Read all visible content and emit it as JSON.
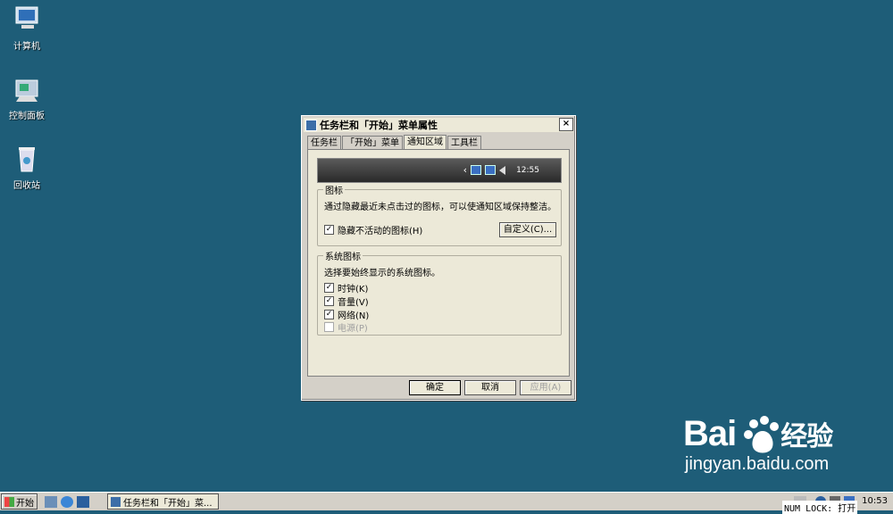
{
  "desktop": {
    "icons": [
      {
        "label": "计算机"
      },
      {
        "label": "控制面板"
      },
      {
        "label": "回收站"
      }
    ]
  },
  "dialog": {
    "title": "任务栏和「开始」菜单属性",
    "close": "×",
    "tabs": [
      "任务栏",
      "「开始」菜单",
      "通知区域",
      "工具栏"
    ],
    "active_tab": "通知区域",
    "preview": {
      "chevron": "‹",
      "time": "12:55"
    },
    "icons_group": {
      "title": "图标",
      "description": "通过隐藏最近未点击过的图标，可以使通知区域保持整洁。",
      "hide_inactive": {
        "label": "隐藏不活动的图标(H)",
        "checked": "✓"
      },
      "customize": "自定义(C)..."
    },
    "system_group": {
      "title": "系统图标",
      "description": "选择要始终显示的系统图标。",
      "items": [
        {
          "label": "时钟(K)",
          "checked": "✓"
        },
        {
          "label": "音量(V)",
          "checked": "✓"
        },
        {
          "label": "网络(N)",
          "checked": "✓"
        },
        {
          "label": "电源(P)",
          "checked": ""
        }
      ]
    },
    "buttons": {
      "ok": "确定",
      "cancel": "取消",
      "apply": "应用(A)"
    }
  },
  "watermark": {
    "brand": "Bai",
    "brand2": "经验",
    "url": "jingyan.baidu.com"
  },
  "taskbar": {
    "start": "开始",
    "task_item": "任务栏和「开始」菜...",
    "numlock": "NUM LOCK: 打开",
    "clock": "10:53"
  }
}
